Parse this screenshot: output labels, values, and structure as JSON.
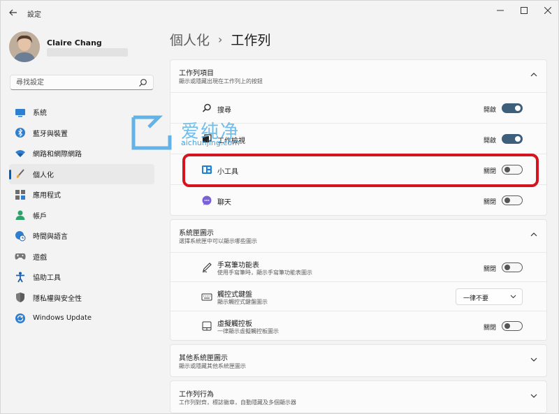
{
  "window": {
    "title": "設定"
  },
  "profile": {
    "name": "Claire Chang"
  },
  "search": {
    "placeholder": "尋找設定"
  },
  "sidebar": {
    "items": [
      {
        "label": "系統",
        "icon": "monitor-icon"
      },
      {
        "label": "藍牙與裝置",
        "icon": "bluetooth-icon"
      },
      {
        "label": "網路和網際網路",
        "icon": "wifi-icon"
      },
      {
        "label": "個人化",
        "icon": "brush-icon",
        "selected": true
      },
      {
        "label": "應用程式",
        "icon": "apps-icon"
      },
      {
        "label": "帳戶",
        "icon": "person-icon"
      },
      {
        "label": "時間與語言",
        "icon": "globe-clock-icon"
      },
      {
        "label": "遊戲",
        "icon": "gamepad-icon"
      },
      {
        "label": "協助工具",
        "icon": "accessibility-icon"
      },
      {
        "label": "隱私權與安全性",
        "icon": "shield-icon"
      },
      {
        "label": "Windows Update",
        "icon": "update-icon"
      }
    ]
  },
  "breadcrumb": {
    "parent": "個人化",
    "separator": "›",
    "current": "工作列"
  },
  "taskbar_items": {
    "title": "工作列項目",
    "description": "顯示或隱藏出現在工作列上的按鈕",
    "rows": [
      {
        "label": "搜尋",
        "state": "開啟",
        "on": true,
        "icon": "search-icon"
      },
      {
        "label": "工作檢視",
        "state": "開啟",
        "on": true,
        "icon": "task-view-icon"
      },
      {
        "label": "小工具",
        "state": "關閉",
        "on": false,
        "icon": "widgets-icon"
      },
      {
        "label": "聊天",
        "state": "關閉",
        "on": false,
        "icon": "chat-icon"
      }
    ]
  },
  "system_tray": {
    "title": "系統匣圖示",
    "description": "選擇系統匣中可以顯示哪些圖示",
    "rows": [
      {
        "label": "手寫筆功能表",
        "sub": "使用手寫筆時，顯示手寫筆功能表圖示",
        "state": "關閉",
        "on": false,
        "icon": "pen-icon"
      },
      {
        "label": "觸控式鍵盤",
        "sub": "顯示觸控式鍵盤圖示",
        "dropdown": "一律不要",
        "icon": "keyboard-icon"
      },
      {
        "label": "虛擬觸控板",
        "sub": "一律顯示虛擬觸控板圖示",
        "state": "關閉",
        "on": false,
        "icon": "touchpad-icon"
      }
    ]
  },
  "other_tray": {
    "title": "其他系統匣圖示",
    "description": "顯示或隱藏其他系統匣圖示"
  },
  "taskbar_behavior": {
    "title": "工作列行為",
    "description": "工作列對齊，標誌徽章，自動隱藏及多個顯示器"
  },
  "watermark": {
    "text": "爱纯净",
    "url": "aichunjing.com"
  },
  "colors": {
    "accent": "#005fb8",
    "toggle_on": "#3d5f7c",
    "highlight": "#d4151f"
  }
}
